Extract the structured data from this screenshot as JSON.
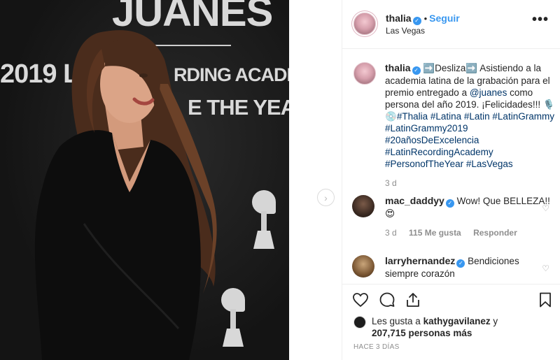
{
  "post": {
    "username": "thalia",
    "follow_label": "Seguir",
    "location": "Las Vegas",
    "more_label": "•••"
  },
  "photo": {
    "backdrop_lines": [
      "JUANES",
      "2019 L",
      "RDING ACADEMY®",
      "E THE YEAR"
    ]
  },
  "caption": {
    "username": "thalia",
    "text_1": "➡️Desliza➡️ Asistiendo a la academia latina de la grabación para el premio entregado a ",
    "mention": "@juanes",
    "text_2": " como persona del año 2019. ¡Felicidades!!! 🎙️💿",
    "hashtags": "#Thalia #Latina #Latin #LatinGrammy #LatinGrammy2019 #20añosDeExcelencia #LatinRecordingAcademy #PersonofTheYear #LasVegas",
    "time": "3 d"
  },
  "comments": [
    {
      "username": "mac_daddyy",
      "text": "Wow! Que BELLEZA!! 😍",
      "time": "3 d",
      "likes": "115 Me gusta",
      "reply_label": "Responder"
    },
    {
      "username": "larryhernandez",
      "text": "Bendiciones siempre corazón"
    }
  ],
  "likes": {
    "prefix": "Les gusta a ",
    "first_user": "kathygavilanez",
    "connector": " y",
    "count_text": "207,715 personas más"
  },
  "timestamp": "HACE 3 DÍAS",
  "colors": {
    "link_blue": "#3897f0",
    "hashtag_blue": "#003569",
    "muted": "#8e8e8e",
    "border": "#efefef"
  }
}
